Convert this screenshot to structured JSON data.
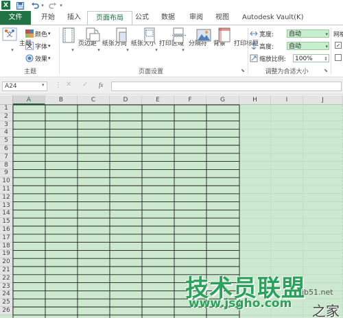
{
  "app": {
    "logo": "X"
  },
  "quick_access": {
    "save_icon": "save-icon",
    "undo_icon": "undo-icon",
    "redo_icon": "redo-icon"
  },
  "tabs": [
    {
      "label": "文件"
    },
    {
      "label": "开始"
    },
    {
      "label": "插入"
    },
    {
      "label": "页面布局"
    },
    {
      "label": "公式"
    },
    {
      "label": "数据"
    },
    {
      "label": "审阅"
    },
    {
      "label": "视图"
    },
    {
      "label": "Autodesk Vault(K)"
    }
  ],
  "ribbon": {
    "theme": {
      "themes": "主题",
      "colors": "颜色",
      "fonts": "字体",
      "effects": "效果",
      "group_label": "主题"
    },
    "page_setup": {
      "margins": "页边距",
      "orientation": "纸张方向",
      "size": "纸张大小",
      "print_area": "打印区域",
      "breaks": "分隔符",
      "background": "背景",
      "print_titles": "打印标题",
      "group_label": "页面设置"
    },
    "scale_to_fit": {
      "width_label": "宽度:",
      "width_value": "自动",
      "height_label": "高度:",
      "height_value": "自动",
      "scale_label": "缩放比例:",
      "scale_value": "100%",
      "group_label": "调整为合适大小"
    },
    "sheet_options": {
      "label": "网格"
    }
  },
  "formula_bar": {
    "name_box": "A24",
    "fx": "fx"
  },
  "grid": {
    "columns": [
      "A",
      "B",
      "C",
      "D",
      "E",
      "F",
      "G",
      "H",
      "I",
      "J"
    ],
    "rows": [
      "1",
      "2",
      "3",
      "4",
      "5",
      "6",
      "7",
      "8",
      "9",
      "10",
      "11",
      "12",
      "13",
      "14",
      "15",
      "16",
      "17",
      "18",
      "19",
      "20",
      "21",
      "22",
      "23",
      "24",
      "25",
      "26"
    ],
    "active_cell": "A24",
    "colors": {
      "sheet_bg": "#cce8cf",
      "accent": "#217346"
    }
  },
  "watermark": {
    "main": "技术员联盟",
    "url": "www.jsgho.com",
    "site": "jb51.net",
    "home": "之家"
  }
}
